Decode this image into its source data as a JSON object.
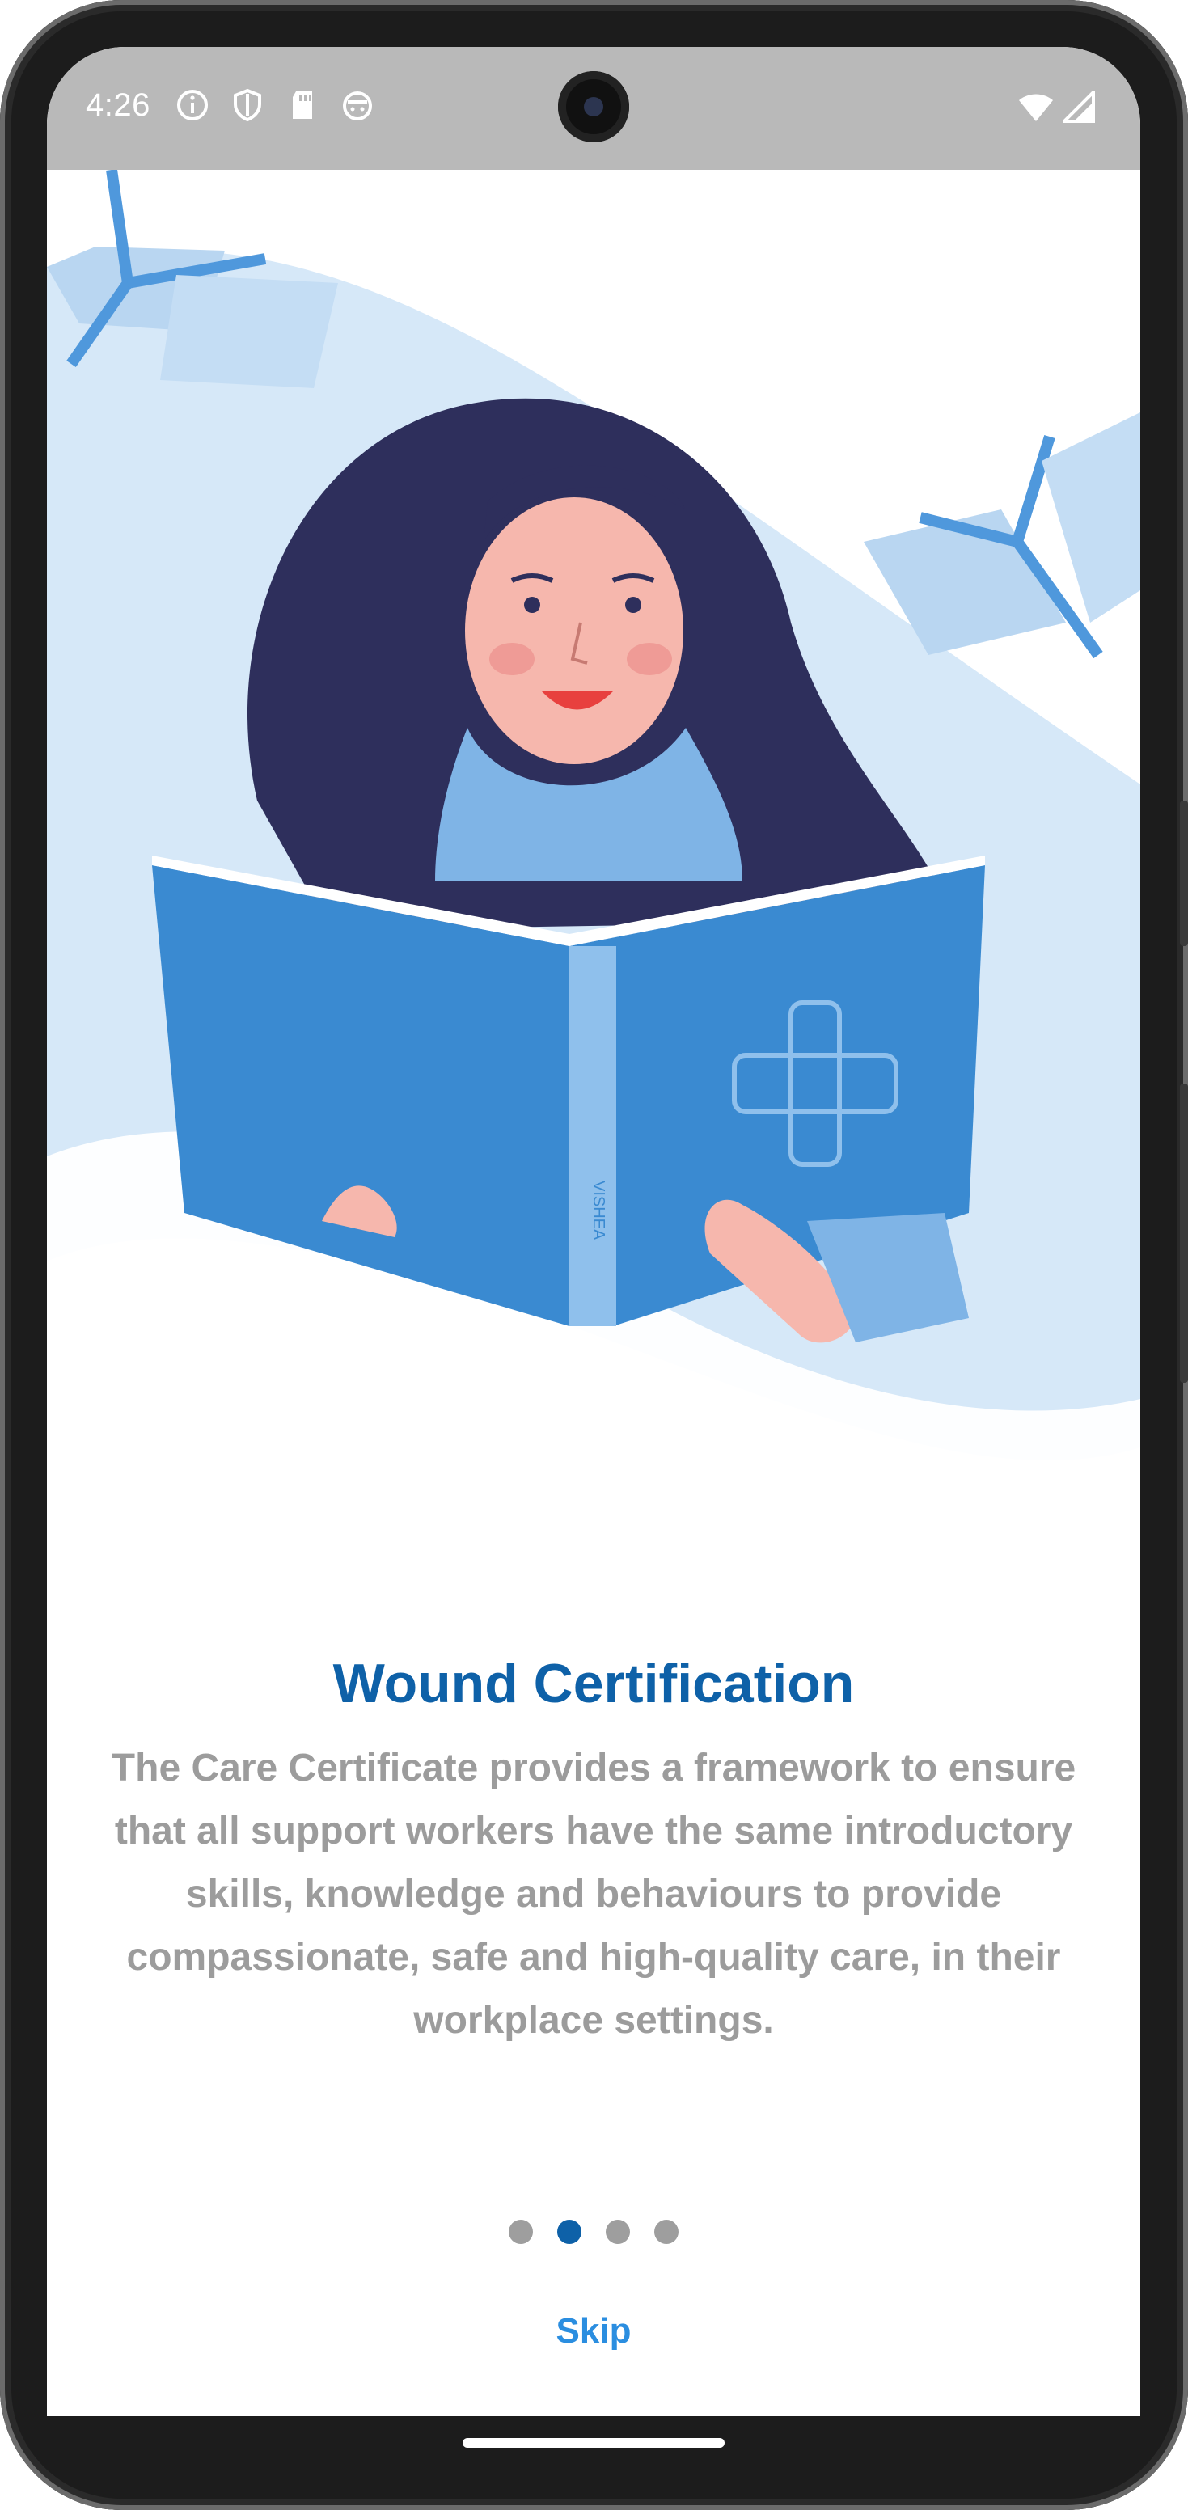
{
  "status_bar": {
    "time": "4:26",
    "left_icons": [
      "info-icon",
      "shield-icon",
      "sd-card-icon",
      "cat-face-icon"
    ],
    "right_icons": [
      "wifi-icon",
      "signal-icon"
    ]
  },
  "onboarding": {
    "title": "Wound Certification",
    "description": "The Care Certificate provides a framework to ensure that all support workers have the same introductory skills, knowledge and behaviours to provide compassionate, safe and high-quality care, in their workplace settings.",
    "page_count": 4,
    "active_page": 2,
    "skip_label": "Skip"
  },
  "illustration": {
    "book_spine_text": "VISHEA"
  },
  "colors": {
    "accent": "#0e61a8",
    "skip": "#2b8ee0",
    "text_muted": "#9c9c9c",
    "book_blue": "#3a8ad1",
    "light_blue": "#cfe3f7"
  }
}
